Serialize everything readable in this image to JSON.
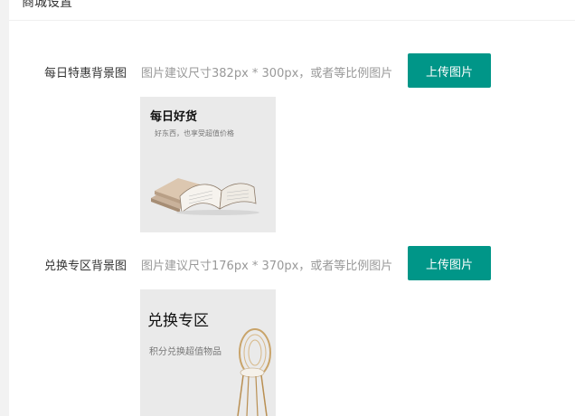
{
  "header": {
    "title": "商城设置"
  },
  "rows": [
    {
      "label": "每日特惠背景图",
      "hint": "图片建议尺寸382px * 300px，或者等比例图片",
      "button": "上传图片",
      "preview": {
        "title": "每日好货",
        "subtitle": "好东西，也享受超值价格",
        "graphic": "open-book-illustration"
      }
    },
    {
      "label": "兑换专区背景图",
      "hint": "图片建议尺寸176px * 370px，或者等比例图片",
      "button": "上传图片",
      "preview": {
        "title": "兑换专区",
        "subtitle": "积分兑换超值物品",
        "graphic": "rattan-chair-illustration"
      }
    }
  ],
  "colors": {
    "primary_button": "#009688",
    "preview_bg": "#eaeaea",
    "hint_text": "#999999"
  }
}
